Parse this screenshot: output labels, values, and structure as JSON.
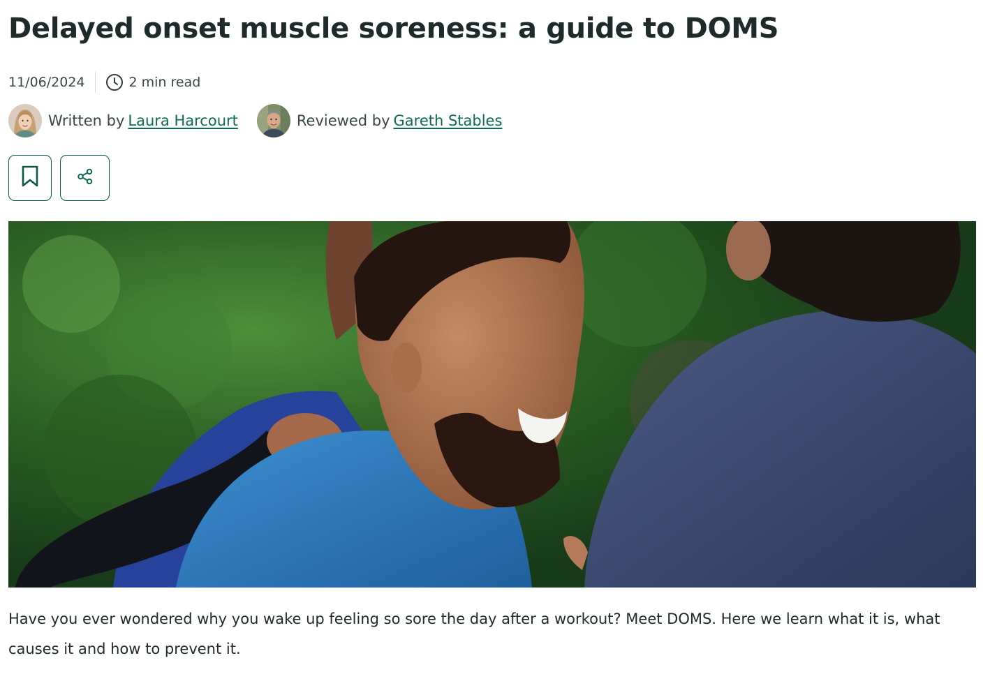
{
  "article": {
    "title": "Delayed onset muscle soreness: a guide to DOMS",
    "date": "11/06/2024",
    "read_time": "2 min read",
    "read_time_icon": "clock-icon",
    "author": {
      "label": "Written by",
      "name": "Laura Harcourt"
    },
    "reviewer": {
      "label": "Reviewed by",
      "name": "Gareth Stables"
    },
    "actions": {
      "bookmark_icon": "bookmark-icon",
      "share_icon": "share-icon"
    },
    "hero_image": "three-men-laughing-outdoors-photo",
    "intro": "Have you ever wondered why you wake up feeling so sore the day after a workout? Meet DOMS. Here we learn what it is, what causes it and how to prevent it."
  },
  "colors": {
    "text": "#1f2b2b",
    "link": "#0b6b54",
    "button_border": "#0b5a4a"
  }
}
